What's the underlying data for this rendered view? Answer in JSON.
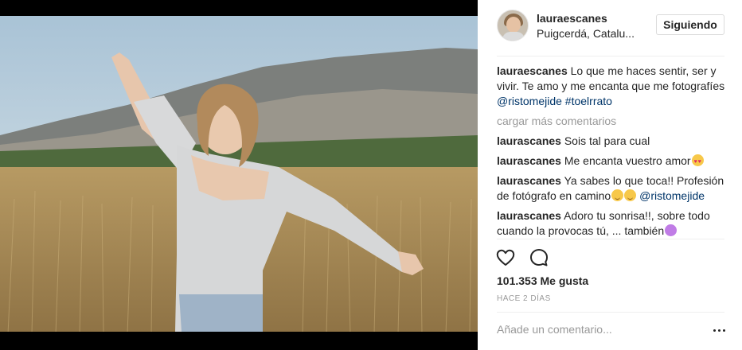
{
  "post": {
    "username": "lauraescanes",
    "location": "Puigcerdá, Catalu...",
    "follow_label": "Siguiendo"
  },
  "caption": {
    "username": "lauraescanes",
    "text": "Lo que me haces sentir, ser y vivir. Te amo y me encanta que me fotografíes",
    "mention": "@ristomejide",
    "hashtag": "#toelrrato"
  },
  "load_more_label": "cargar más comentarios",
  "comments": [
    {
      "username": "laurascanes",
      "text": "Sois tal para cual",
      "emoji": ""
    },
    {
      "username": "laurascanes",
      "text": "Me encanta vuestro amor",
      "emoji": "heart-eyes"
    },
    {
      "username": "laurascanes",
      "text": "Ya sabes lo que toca!! Profesión de fotógrafo en camino",
      "emoji": "relieved",
      "mention": "@ristomejide"
    },
    {
      "username": "laurascanes",
      "text": "Adoro tu sonrisa!!, sobre todo cuando la provocas tú, ... también",
      "emoji": "purple"
    }
  ],
  "likes_label": "101.353 Me gusta",
  "time_label": "HACE 2 DÍAS",
  "add_comment_placeholder": "Añade un comentario...",
  "icons": [
    "heart-icon",
    "comment-icon",
    "more-options-icon"
  ],
  "colors": {
    "link": "#003569",
    "muted": "#999999",
    "text": "#262626",
    "border": "#efefef"
  }
}
